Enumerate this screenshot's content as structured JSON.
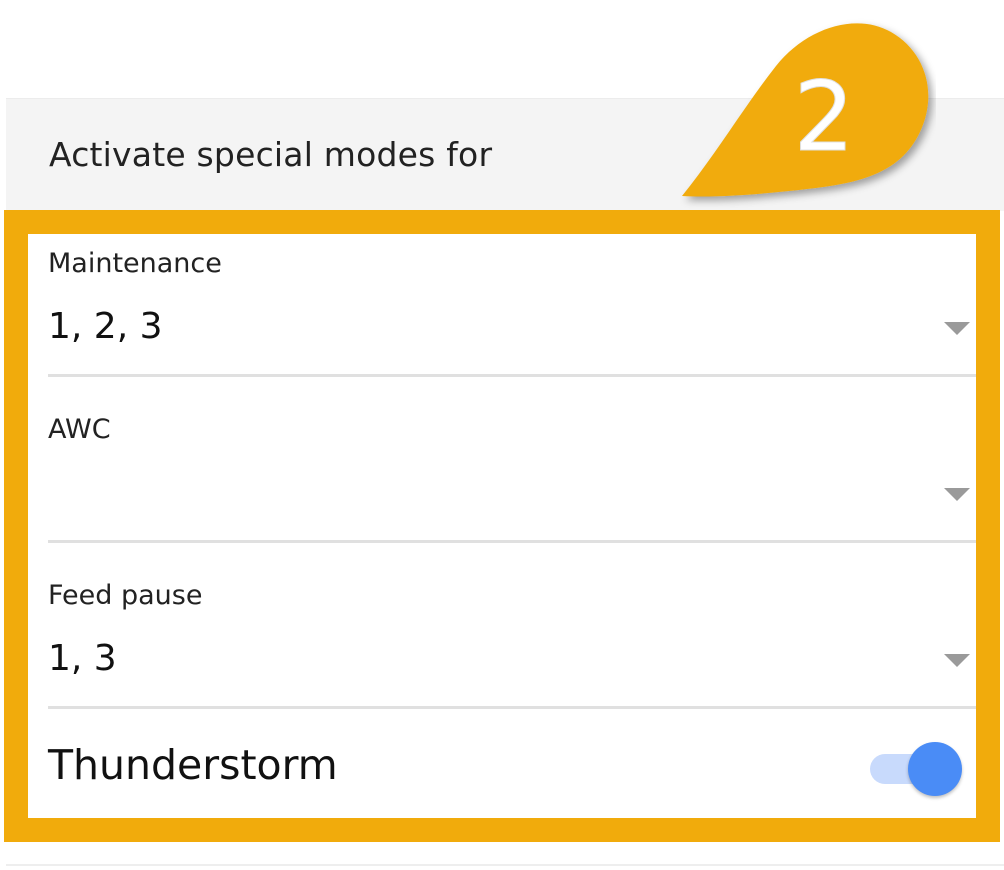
{
  "header": {
    "title": "Activate special modes for"
  },
  "callout": {
    "number": "2",
    "color": "#f1ab0c"
  },
  "fields": [
    {
      "label": "Maintenance",
      "value": "1, 2, 3",
      "icon": "chevron-down-icon"
    },
    {
      "label": "AWC",
      "value": "",
      "icon": "chevron-down-icon"
    },
    {
      "label": "Feed pause",
      "value": "1, 3",
      "icon": "chevron-down-icon"
    }
  ],
  "thunderstorm": {
    "label": "Thunderstorm",
    "enabled": true,
    "accent": "#4a8cf6"
  },
  "highlight_color": "#f1ab0c"
}
